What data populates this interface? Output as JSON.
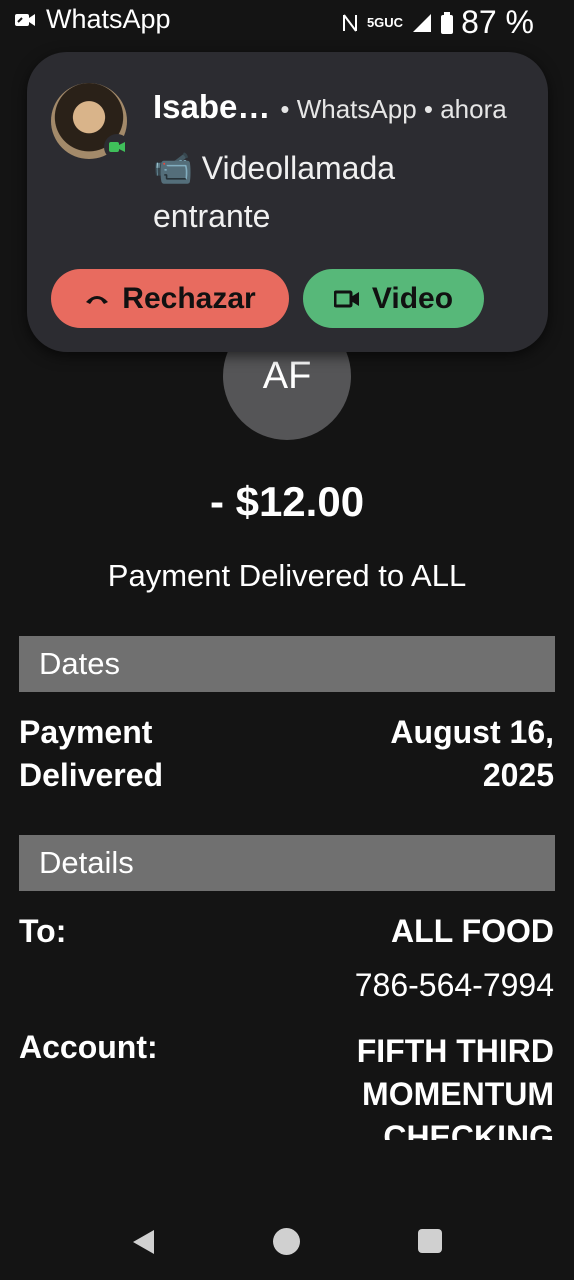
{
  "status_bar": {
    "app_name": "WhatsApp",
    "network": "5GUC",
    "battery": "87 %"
  },
  "notification": {
    "caller_name": "Isabe…",
    "meta": "• WhatsApp • ahora",
    "message_emoji": "📹",
    "message": "Videollamada entrante",
    "reject_label": "Rechazar",
    "video_label": "Video"
  },
  "payment": {
    "avatar_initials": "AF",
    "amount": "- $12.00",
    "subtitle": "Payment Delivered to ALL"
  },
  "dates_section": {
    "title": "Dates",
    "label_line1": "Payment",
    "label_line2": "Delivered",
    "date_line1": "August 16,",
    "date_line2": "2025"
  },
  "details_section": {
    "title": "Details",
    "to_label": "To:",
    "to_name": "ALL FOOD",
    "to_phone": "786-564-7994",
    "account_label": "Account:",
    "account_line1": "FIFTH THIRD",
    "account_line2": "MOMENTUM",
    "account_line3": "CHECKING"
  },
  "colors": {
    "background": "#141414",
    "section_bar": "#707070",
    "notification_bg": "#2c2c31",
    "reject_button": "#e86b5f",
    "video_button": "#57b879"
  },
  "icons": [
    "video-call-icon",
    "signal-icon",
    "battery-icon",
    "phone-hangup-icon",
    "video-camera-icon",
    "back-icon",
    "home-icon",
    "recents-icon"
  ]
}
